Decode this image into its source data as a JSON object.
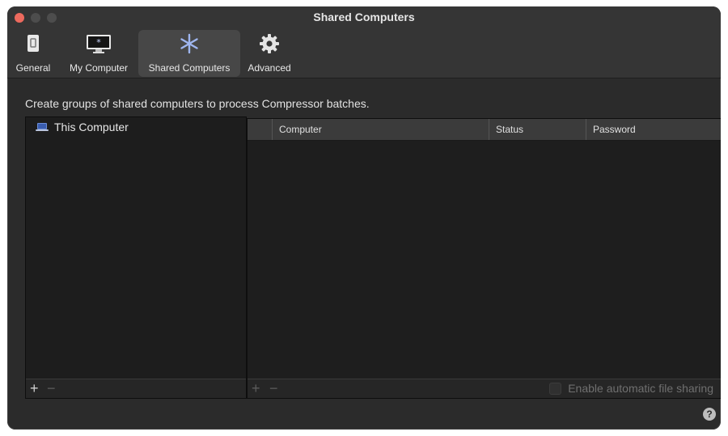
{
  "window": {
    "title": "Shared Computers"
  },
  "toolbar": {
    "tabs": [
      {
        "label": "General",
        "icon": "switch-icon"
      },
      {
        "label": "My Computer",
        "icon": "monitor-icon"
      },
      {
        "label": "Shared Computers",
        "icon": "asterisk-network-icon",
        "selected": true
      },
      {
        "label": "Advanced",
        "icon": "gear-icon"
      }
    ]
  },
  "main": {
    "description": "Create groups of shared computers to process Compressor batches.",
    "groups": [
      {
        "label": "This Computer",
        "icon": "laptop-icon"
      }
    ],
    "table": {
      "columns": [
        "Computer",
        "Status",
        "Password"
      ],
      "rows": []
    },
    "left_add": "+",
    "left_remove": "−",
    "right_add": "+",
    "right_remove": "−",
    "file_sharing_label": "Enable automatic file sharing",
    "file_sharing_checked": false,
    "help": "?"
  },
  "colors": {
    "window_bg": "#2b2b2b",
    "titlebar_bg": "#353535",
    "close_button": "#ed6a5e",
    "selected_tab": "#474747",
    "table_header": "#3b3b3b",
    "panel_bg": "#1e1e1e"
  }
}
